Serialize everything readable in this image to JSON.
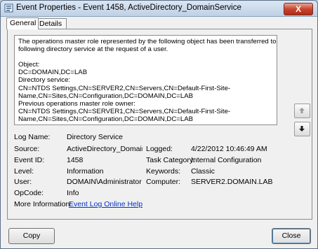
{
  "window": {
    "title": "Event Properties - Event 1458, ActiveDirectory_DomainService",
    "close_symbol": "X"
  },
  "tabs": [
    {
      "label": "General"
    },
    {
      "label": "Details"
    }
  ],
  "message": {
    "lines": [
      "The operations master role represented by the following object has been transferred to the",
      "following directory service at the request of a user.",
      "",
      "Object:",
      "DC=DOMAIN,DC=LAB",
      "Directory service:",
      "CN=NTDS Settings,CN=SERVER2,CN=Servers,CN=Default-First-Site-",
      "Name,CN=Sites,CN=Configuration,DC=DOMAIN,DC=LAB",
      "Previous operations master role owner:",
      "CN=NTDS Settings,CN=SERVER1,CN=Servers,CN=Default-First-Site-",
      "Name,CN=Sites,CN=Configuration,DC=DOMAIN,DC=LAB"
    ]
  },
  "fields": {
    "log_name": {
      "label": "Log Name:",
      "value": "Directory Service"
    },
    "source": {
      "label": "Source:",
      "value": "ActiveDirectory_DomainServ"
    },
    "logged": {
      "label": "Logged:",
      "value": "4/22/2012 10:46:49 AM"
    },
    "event_id": {
      "label": "Event ID:",
      "value": "1458"
    },
    "task_category": {
      "label": "Task Category:",
      "value": "Internal Configuration"
    },
    "level": {
      "label": "Level:",
      "value": "Information"
    },
    "keywords": {
      "label": "Keywords:",
      "value": "Classic"
    },
    "user": {
      "label": "User:",
      "value": "DOMAIN\\Administrator"
    },
    "computer": {
      "label": "Computer:",
      "value": "SERVER2.DOMAIN.LAB"
    },
    "opcode": {
      "label": "OpCode:",
      "value": "Info"
    },
    "more_info": {
      "label": "More Information:",
      "link": "Event Log Online Help"
    }
  },
  "buttons": {
    "copy": "Copy",
    "close": "Close"
  },
  "icons": {
    "title": "event-viewer-icon",
    "up": "arrow-up-icon",
    "down": "arrow-down-icon"
  }
}
